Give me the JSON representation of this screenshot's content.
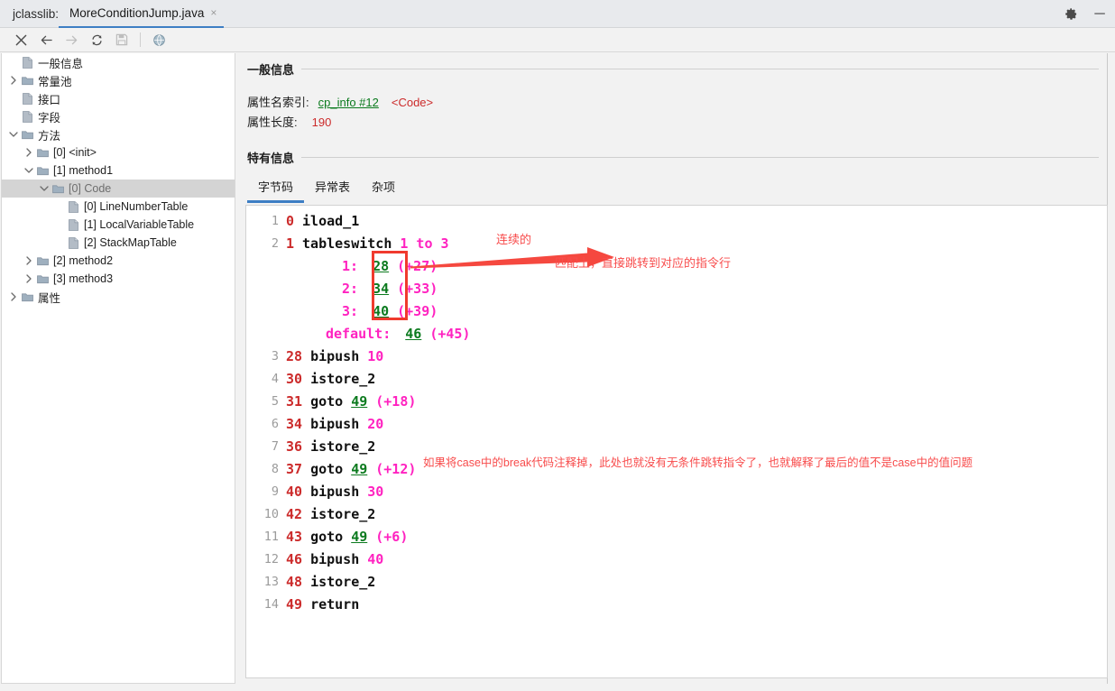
{
  "titlebar": {
    "app_label": "jclasslib:",
    "tab_title": "MoreConditionJump.java",
    "close_glyph": "×",
    "settings_glyph": "⚙",
    "minimize_glyph": "─"
  },
  "toolbar": {
    "buttons": [
      {
        "name": "close-icon",
        "glyph": "✕",
        "dim": false
      },
      {
        "name": "back-icon",
        "glyph": "←",
        "dim": false
      },
      {
        "name": "forward-icon",
        "glyph": "→",
        "dim": true
      },
      {
        "name": "reload-icon",
        "glyph": "↻",
        "dim": false
      },
      {
        "name": "save-icon",
        "glyph": "Ὃe",
        "dim": true
      }
    ],
    "browser_icon": "globe-icon"
  },
  "tree": {
    "items": [
      {
        "label": "一般信息",
        "indent": 1,
        "twisty": "",
        "icon": "file",
        "selected": false
      },
      {
        "label": "常量池",
        "indent": 1,
        "twisty": ">",
        "icon": "folder",
        "selected": false
      },
      {
        "label": "接口",
        "indent": 1,
        "twisty": "",
        "icon": "file",
        "selected": false
      },
      {
        "label": "字段",
        "indent": 1,
        "twisty": "",
        "icon": "file",
        "selected": false
      },
      {
        "label": "方法",
        "indent": 1,
        "twisty": "v",
        "icon": "folder",
        "selected": false
      },
      {
        "label": "[0] <init>",
        "indent": 2,
        "twisty": ">",
        "icon": "folder",
        "selected": false
      },
      {
        "label": "[1] method1",
        "indent": 2,
        "twisty": "v",
        "icon": "folder",
        "selected": false
      },
      {
        "label": "[0] Code",
        "indent": 3,
        "twisty": "v",
        "icon": "folder",
        "selected": true
      },
      {
        "label": "[0] LineNumberTable",
        "indent": 4,
        "twisty": "",
        "icon": "file",
        "selected": false
      },
      {
        "label": "[1] LocalVariableTable",
        "indent": 4,
        "twisty": "",
        "icon": "file",
        "selected": false
      },
      {
        "label": "[2] StackMapTable",
        "indent": 4,
        "twisty": "",
        "icon": "file",
        "selected": false
      },
      {
        "label": "[2] method2",
        "indent": 2,
        "twisty": ">",
        "icon": "folder",
        "selected": false
      },
      {
        "label": "[3] method3",
        "indent": 2,
        "twisty": ">",
        "icon": "folder",
        "selected": false
      },
      {
        "label": "属性",
        "indent": 1,
        "twisty": ">",
        "icon": "folder",
        "selected": false
      }
    ]
  },
  "general_info": {
    "heading": "一般信息",
    "name_index_label": "属性名索引:",
    "name_index_link": "cp_info #12",
    "name_index_value": "<Code>",
    "length_label": "属性长度:",
    "length_value": "190"
  },
  "specific_info": {
    "heading": "特有信息",
    "tabs": [
      {
        "label": "字节码",
        "active": true
      },
      {
        "label": "异常表",
        "active": false
      },
      {
        "label": "杂项",
        "active": false
      }
    ]
  },
  "annotations": {
    "continuous": "连续的",
    "arrow_text": "匹配上，直接跳转到对应的指令行",
    "goto_note": "如果将case中的break代码注释掉，此处也就没有无条件跳转指令了，也就解释了最后的值不是case中的值问题"
  },
  "bytecode": {
    "lines": [
      {
        "no": "1",
        "offset": "0",
        "mnemonic": "iload_1",
        "args": []
      },
      {
        "no": "2",
        "offset": "1",
        "mnemonic": "tableswitch",
        "args": [
          {
            "t": "num",
            "v": "1 to 3"
          }
        ]
      },
      {
        "no": "",
        "offset": "",
        "mnemonic": "",
        "args": [],
        "switch_case": {
          "key": "1:",
          "target": "28",
          "delta": "(+27)"
        }
      },
      {
        "no": "",
        "offset": "",
        "mnemonic": "",
        "args": [],
        "switch_case": {
          "key": "2:",
          "target": "34",
          "delta": "(+33)"
        }
      },
      {
        "no": "",
        "offset": "",
        "mnemonic": "",
        "args": [],
        "switch_case": {
          "key": "3:",
          "target": "40",
          "delta": "(+39)"
        }
      },
      {
        "no": "",
        "offset": "",
        "mnemonic": "",
        "args": [],
        "switch_case": {
          "key": "default:",
          "target": "46",
          "delta": "(+45)"
        }
      },
      {
        "no": "3",
        "offset": "28",
        "mnemonic": "bipush",
        "args": [
          {
            "t": "num",
            "v": "10"
          }
        ]
      },
      {
        "no": "4",
        "offset": "30",
        "mnemonic": "istore_2",
        "args": []
      },
      {
        "no": "5",
        "offset": "31",
        "mnemonic": "goto",
        "args": [
          {
            "t": "tgt",
            "v": "49"
          },
          {
            "t": "paren",
            "v": "(+18)"
          }
        ]
      },
      {
        "no": "6",
        "offset": "34",
        "mnemonic": "bipush",
        "args": [
          {
            "t": "num",
            "v": "20"
          }
        ]
      },
      {
        "no": "7",
        "offset": "36",
        "mnemonic": "istore_2",
        "args": []
      },
      {
        "no": "8",
        "offset": "37",
        "mnemonic": "goto",
        "args": [
          {
            "t": "tgt",
            "v": "49"
          },
          {
            "t": "paren",
            "v": "(+12)"
          }
        ]
      },
      {
        "no": "9",
        "offset": "40",
        "mnemonic": "bipush",
        "args": [
          {
            "t": "num",
            "v": "30"
          }
        ]
      },
      {
        "no": "10",
        "offset": "42",
        "mnemonic": "istore_2",
        "args": []
      },
      {
        "no": "11",
        "offset": "43",
        "mnemonic": "goto",
        "args": [
          {
            "t": "tgt",
            "v": "49"
          },
          {
            "t": "paren",
            "v": "(+6)"
          }
        ]
      },
      {
        "no": "12",
        "offset": "46",
        "mnemonic": "bipush",
        "args": [
          {
            "t": "num",
            "v": "40"
          }
        ]
      },
      {
        "no": "13",
        "offset": "48",
        "mnemonic": "istore_2",
        "args": []
      },
      {
        "no": "14",
        "offset": "49",
        "mnemonic": "return",
        "args": []
      }
    ]
  },
  "colors": {
    "accent": "#3d7ec4",
    "offset": "#cc2b2b",
    "number": "#ff22c0",
    "target": "#0b7a1e",
    "annotation": "#f84c4c",
    "highlight_box": "#f03a2e"
  }
}
